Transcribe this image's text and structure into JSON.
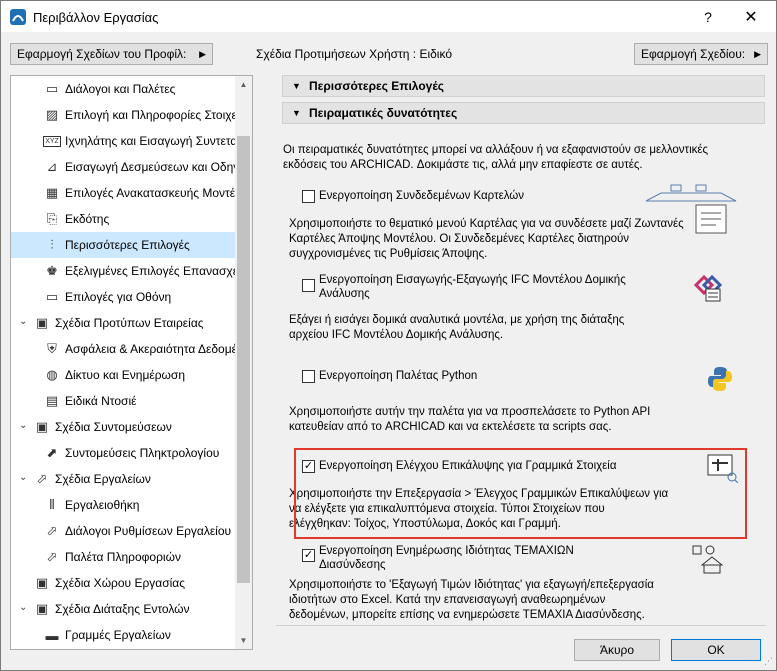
{
  "window": {
    "title": "Περιβάλλον Εργασίας",
    "help": "?",
    "close": "✕"
  },
  "toolbar": {
    "apply_profile_button": "Εφαρμογή Σχεδίων του Προφίλ:",
    "profile_label": "Σχέδια Προτιμήσεων Χρήστη :  Ειδικό",
    "apply_scheme_button": "Εφαρμογή Σχεδίου:"
  },
  "tree": {
    "items": [
      {
        "label": "Διάλογοι και Παλέτες",
        "icon": "dialog-icon"
      },
      {
        "label": "Επιλογή και Πληροφορίες Στοιχείων",
        "icon": "selection-icon"
      },
      {
        "label": "Ιχνηλάτης και Εισαγωγή Συντεταγμένων",
        "icon": "tracker-icon"
      },
      {
        "label": "Εισαγωγή Δεσμεύσεων και Οδηγών",
        "icon": "constraints-icon"
      },
      {
        "label": "Επιλογές Ανακατασκευής Μοντέλου",
        "icon": "rebuild-icon"
      },
      {
        "label": "Εκδότης",
        "icon": "publisher-icon"
      },
      {
        "label": "Περισσότερες Επιλογές",
        "icon": "more-options-icon"
      },
      {
        "label": "Εξελιγμένες Επιλογές Επανασχεδίασης",
        "icon": "redraw-icon"
      },
      {
        "label": "Επιλογές για Οθόνη",
        "icon": "display-icon"
      },
      {
        "label": "Σχέδια Προτύπων Εταιρείας",
        "icon": "company-icon"
      },
      {
        "label": "Ασφάλεια & Ακεραιότητα Δεδομένων",
        "icon": "safety-icon"
      },
      {
        "label": "Δίκτυο και Ενημέρωση",
        "icon": "network-icon"
      },
      {
        "label": "Ειδικά Ντοσιέ",
        "icon": "folder-icon"
      },
      {
        "label": "Σχέδια Συντομεύσεων",
        "icon": "shortcut-scheme-icon"
      },
      {
        "label": "Συντομεύσεις Πληκτρολογίου",
        "icon": "keyboard-icon"
      },
      {
        "label": "Σχέδια Εργαλείων",
        "icon": "tool-scheme-icon"
      },
      {
        "label": "Εργαλειοθήκη",
        "icon": "toolbox-icon"
      },
      {
        "label": "Διάλογοι Ρυθμίσεων Εργαλείου",
        "icon": "tool-settings-icon"
      },
      {
        "label": "Παλέτα Πληροφοριών",
        "icon": "info-palette-icon"
      },
      {
        "label": "Σχέδια Χώρου Εργασίας",
        "icon": "workspace-icon"
      },
      {
        "label": "Σχέδια Διάταξης Εντολών",
        "icon": "command-layout-icon"
      },
      {
        "label": "Γραμμές Εργαλείων",
        "icon": "toolbars-icon"
      }
    ]
  },
  "right": {
    "section1": "Περισσότερες Επιλογές",
    "section2": "Πειραματικές δυνατότητες",
    "intro": [
      "Οι πειραματικές δυνατότητες μπορεί να αλλάξουν ή να εξαφανιστούν σε μελλοντικές",
      "εκδόσεις του ARCHICAD. Δοκιμάστε τις, αλλά μην επαφίεστε σε αυτές."
    ],
    "opt1": {
      "label": "Ενεργοποίηση Συνδεδεμένων Καρτελών",
      "desc": [
        "Χρησιμοποιήστε το θεματικό μενού Καρτέλας για να συνδέσετε μαζί Ζωντανές",
        "Καρτέλες Άποψης Μοντέλου. Οι Συνδεδεμένες Καρτέλες διατηρούν",
        "συγχρονισμένες τις Ρυθμίσεις Άποψης."
      ]
    },
    "opt2": {
      "label": [
        "Ενεργοποίηση Εισαγωγής-Εξαγωγής IFC Μοντέλου Δομικής",
        "Ανάλυσης"
      ],
      "desc": [
        "Εξάγει ή εισάγει δομικά αναλυτικά μοντέλα, με χρήση της διάταξης",
        "αρχείου IFC Μοντέλου Δομικής Ανάλυσης."
      ]
    },
    "opt3": {
      "label": "Ενεργοποίηση Παλέτας Python",
      "desc": [
        "Χρησιμοποιήστε αυτήν την παλέτα για να προσπελάσετε το Python API",
        "κατευθείαν από το ARCHICAD και να εκτελέσετε τα scripts σας."
      ]
    },
    "opt4": {
      "label": "Ενεργοποίηση Ελέγχου Επικάλυψης για Γραμμικά Στοιχεία",
      "desc": [
        "Χρησιμοποιήστε την Επεξεργασία > Έλεγχος Γραμμικών Επικαλύψεων για",
        "να ελέγξετε για επικαλυπτόμενα στοιχεία. Τύποι Στοιχείων που",
        "ελέγχθηκαν: Τοίχος, Υποστύλωμα, Δοκός και Γραμμή."
      ]
    },
    "opt5": {
      "label": [
        "Ενεργοποίηση Ενημέρωσης Ιδιότητας ΤΕΜΑΧΙΩΝ",
        "Διασύνδεσης"
      ],
      "desc": [
        "Χρησιμοποιήστε το 'Εξαγωγή Τιμών Ιδιότητας' για εξαγωγή/επεξεργασία",
        "ιδιοτήτων στο Excel. Κατά την επανεισαγωγή αναθεωρημένων",
        "δεδομένων, μπορείτε επίσης να ενημερώσετε ΤΕΜΑΧΙΑ Διασύνδεσης."
      ]
    }
  },
  "footer": {
    "cancel": "Άκυρο",
    "ok": "OK"
  }
}
